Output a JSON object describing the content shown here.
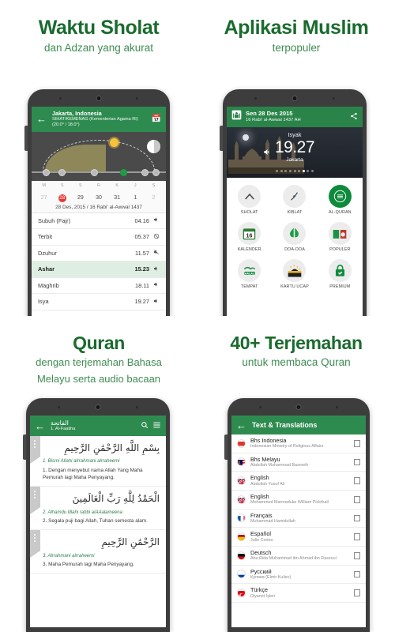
{
  "panels": [
    {
      "title": "Waktu Sholat",
      "subtitle": "dan Adzan yang akurat"
    },
    {
      "title": "Aplikasi Muslim",
      "subtitle": "terpopuler"
    },
    {
      "title": "Quran",
      "subtitle_line1": "dengan terjemahan Bahasa",
      "subtitle_line2": "Melayu serta audio bacaan"
    },
    {
      "title": "40+ Terjemahan",
      "subtitle": "untuk membaca Quran"
    }
  ],
  "phone1": {
    "appbar": {
      "back_icon": "arrow-left-icon",
      "city": "Jakarta, Indonesia",
      "method": "SIHAT/KEMENAG (Kementerian Agama RI)",
      "angles": "(20.0° / 18.0°)",
      "calendar_icon": "calendar-icon"
    },
    "calendar": {
      "day_letters": [
        "M",
        "S",
        "S",
        "R",
        "K",
        "J",
        "S"
      ],
      "dates": [
        "27",
        "28",
        "29",
        "30",
        "31",
        "1",
        "2"
      ],
      "selected_index": 1,
      "muted_indices": [
        0,
        6
      ],
      "date_line": "28 Des, 2015 / 16 Rabi' al-Awwal 1437"
    },
    "prayers": [
      {
        "name": "Subuh (Fajr)",
        "time": "04.16",
        "icon": "speaker-icon",
        "active": false
      },
      {
        "name": "Terbit",
        "time": "05.37",
        "icon": "muted-icon",
        "active": false
      },
      {
        "name": "Dzuhur",
        "time": "11.57",
        "icon": "speaker-off-icon",
        "active": false
      },
      {
        "name": "Ashar",
        "time": "15.23",
        "icon": "speaker-icon",
        "active": true
      },
      {
        "name": "Maghrib",
        "time": "18.11",
        "icon": "speaker-icon",
        "active": false
      },
      {
        "name": "Isya",
        "time": "19.27",
        "icon": "speaker-icon",
        "active": false
      }
    ]
  },
  "phone2": {
    "appbar": {
      "app_icon": "mosque-app-icon",
      "date": "Sen 28 Des 2015",
      "hijri": "16 Rabi' al-Awwal 1437 AH",
      "share_icon": "share-icon"
    },
    "hero": {
      "label": "Isyak",
      "time": "19.27",
      "city": "Jakarta",
      "speaker_icon": "speaker-icon",
      "dots_total": 9,
      "dots_active_index": 6
    },
    "grid": [
      {
        "label": "SHOLAT",
        "icon": "prayer-mat-icon"
      },
      {
        "label": "KIBLAT",
        "icon": "compass-icon"
      },
      {
        "label": "AL-QURAN",
        "icon": "quran-icon"
      },
      {
        "label": "KALENDER",
        "icon": "calendar-16-icon"
      },
      {
        "label": "DOA-DOA",
        "icon": "praying-hands-icon"
      },
      {
        "label": "POPULER",
        "icon": "open-book-icon"
      },
      {
        "label": "TEMPAT",
        "icon": "halal-icon"
      },
      {
        "label": "KARTU UCAP",
        "icon": "greeting-card-icon"
      },
      {
        "label": "PREMIUM",
        "icon": "lock-check-icon"
      }
    ]
  },
  "phone3": {
    "appbar": {
      "back_icon": "arrow-left-icon",
      "surah_arabic": "الفاتحة",
      "surah_latin": "1. Al-Faatiha",
      "search_icon": "search-icon",
      "menu_icon": "hamburger-menu-icon"
    },
    "verses": [
      {
        "arabic": "بِسْمِ اللَّهِ الرَّحْمَٰنِ الرَّحِيمِ",
        "transliteration": "1. Bismi Allahi alrrahmani alrraheemi",
        "translation": "1. Dengan menyebut nama Allah Yang Maha Pemurah lagi Maha Penyayang."
      },
      {
        "arabic": "الْحَمْدُ لِلَّهِ رَبِّ الْعَالَمِينَ",
        "transliteration": "2. Alhamdu lillahi rabbi alAAalameena",
        "translation": "2. Segala puji bagi Allah, Tuhan semesta alam."
      },
      {
        "arabic": "الرَّحْمَٰنِ الرَّحِيمِ",
        "transliteration": "3. Alrrahmani alrraheemi",
        "translation": "3. Maha Pemurah lagi Maha Penyayang."
      }
    ]
  },
  "phone4": {
    "appbar": {
      "back_icon": "arrow-left-icon",
      "title": "Text & Translations"
    },
    "translations": [
      {
        "language": "Bhs Indonesia",
        "author": "Indonesian Ministry of Religious Affairs",
        "flag": "flag-indonesia",
        "checked": false
      },
      {
        "language": "Bhs Melayu",
        "author": "Abdullah Muhammad Basmeih",
        "flag": "flag-malaysia",
        "checked": false
      },
      {
        "language": "English",
        "author": "Abdullah Yusuf Ali",
        "flag": "flag-uk",
        "checked": false
      },
      {
        "language": "English",
        "author": "Mohammed Marmaduke William Pickthall",
        "flag": "flag-uk",
        "checked": false
      },
      {
        "language": "Français",
        "author": "Muhammad Hamidullah",
        "flag": "flag-france",
        "checked": false
      },
      {
        "language": "Español",
        "author": "Julio Cortes",
        "flag": "flag-spain",
        "checked": false
      },
      {
        "language": "Deutsch",
        "author": "Abu Rida Muhammad ibn Ahmad ibn Rassoul",
        "flag": "flag-germany",
        "checked": false
      },
      {
        "language": "Русский",
        "author": "Кулиев (Elmir Kuliev)",
        "flag": "flag-russia",
        "checked": false
      },
      {
        "language": "Türkçe",
        "author": "Diyanet İşleri",
        "flag": "flag-turkey",
        "checked": false
      }
    ]
  },
  "colors": {
    "brand_green": "#1a6b2e",
    "appbar_green": "#2e8b4f",
    "accent_red": "#e53935",
    "active_row": "#dfeee2"
  }
}
